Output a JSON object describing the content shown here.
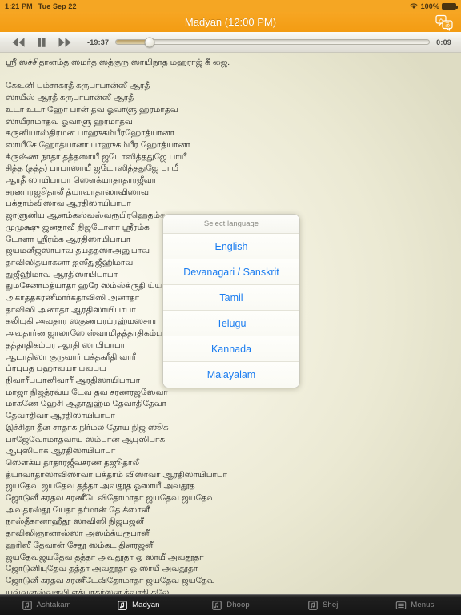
{
  "status_bar": {
    "time": "1:21 PM",
    "date": "Tue Sep 22",
    "battery_percent": "100%",
    "wifi_icon": "wifi-icon",
    "battery_icon": "battery-full-icon"
  },
  "nav_bar": {
    "title": "Madyan (12:00 PM)",
    "translate_icon": "translate-icon",
    "background_color": "#f5a623"
  },
  "transport": {
    "rewind_icon": "rewind-icon",
    "pause_icon": "pause-icon",
    "forward_icon": "fast-forward-icon",
    "elapsed": "-19:37",
    "remaining": "0:09",
    "progress_percent": 11,
    "fill_color": "#c9b584"
  },
  "popover": {
    "header": "Select language",
    "options": [
      {
        "label": "English"
      },
      {
        "label": "Devanagari / Sanskrit"
      },
      {
        "label": "Tamil"
      },
      {
        "label": "Telugu"
      },
      {
        "label": "Kannada"
      },
      {
        "label": "Malayalam"
      }
    ],
    "text_color": "#1a7cf0"
  },
  "lyrics": {
    "lines": [
      "ஸ்ரீ ஸச்சிதானம்த ஸமர்த ஸத்குரு ஸாயிநாத மஹராஜ் கீ ஜை.",
      "",
      "கேஉனி பம்சாகரதீ கருபாபான்ஸீ ஆரதீ",
      "ஸாயீஸ் ஆரதீ கருபாபான்ஸீ ஆரதீ",
      "உடா உடா ஹோ பான் தவ ஓவாளு ஹரமாதவ",
      "ஸாயீராமாதவ ஓவாளு ஹரமாதவ",
      "கருனியாஸ்திரமன பாஹுகம்பீரஹோத்யானா",
      "ஸாயீசே ஹோத்யானா பாஹுகம்பீர ஹோத்யானா",
      "க்ருஷ்ண நாதா தத்தஸாயீ ஜடோஸித்ததுஜே பாயீ",
      "சித்த (தத்த) பாபாஸாயீ ஜடோஸித்ததுஜே பாயீ",
      "ஆரதீ ஸாயிபாபா ஸௌக்யாதாதாரஜீவா",
      "சரணாரஜூதாலீ த்யாவாதாஸாவிஸாவ",
      "பக்தாம்விஸாவ ஆரதிஸாயிபாபா",
      "ஜாளுனிய ஆனம்கஸ்வஸ்வரூபிரஹெதம்க",
      "முமுக்ஷு ஜனதாவீ நிஜடோளா ஸ்ரீரம்க",
      "டோளா ஸ்ரீரம்க ஆரதிஸாயிபாபா",
      "ஜயமனீஜஸாபாவ தயததஸாஅனுபாவ",
      "தாவிஸிதயாகனா ஐஸீதுஜீஹிமாவ",
      "துஜீஹிமாவ ஆரதிஸாயிபாபா",
      "துமசேனாமத்யாதா ஹரே ஸம்ஸ்க்ருதி ய்யாதா",
      "அகாததகரணீமார்கதாவிஸி அனாதா",
      "தாவிஸி அனாதா ஆரதிஸாயிபாபா",
      "கலியுகி அவதார ஸகுணபரப்ரஹ்மஸசார",
      "அவதார்ணஜாலாஸே ஸ்வாமிதத்தாதிகம்பர",
      "தத்தாதிகம்பர ஆரதி ஸாயிபாபா",
      "ஆடாதிஸா குருவார் பக்தகரீதி வாரீ",
      "ப்ரபுபத பஹாவயா பவபய",
      "நிவாரீபயானிவாரீ ஆரதிஸாயிபாபா",
      "மாஜா நிஜத்ரவ்ய டேவ தவ சரணரஜஸேவா",
      "மாகணே ஹேசி ஆதாதுஹ்ம தேவாதிதேவா",
      "தேவாதிவா ஆரதிஸாயிபாபா",
      "இச்சிதா தீன சாதாக நிர்மல தோய நிஜ ஸூக",
      "பாஜேவோமாதவாய ஸம்பான ஆபுஸிபாக",
      "ஆபுஸிபாக ஆரதிஸாயிபாபா",
      "ஸௌக்ய தாதாரஜீவசரண தஜூதாலீ",
      "த்யாவாதாஸாவிஸாவா பக்தாம் விஸாவா ஆரதிஸாயிபாபா",
      "ஜயதேவ ஜயதேவ தத்தா அவதூத ஓஸாயீ அவதூத",
      "ஜோடுனீ கரதவ சரணீடேவிதோமாதா ஜயதேவ ஜயதேவ",
      "அவதரஸ்தூ யேதா தர்மான் தே க்ஸானீ",
      "நாஸ்தீகானாஹீதூ ஸாவிஸி நிஜபஜனீ",
      "தாவிஸிஞானாஸ்ஸா அஸம்க்யரூபானீ",
      "ஹரிஸீ தேவான் சேதூ ஸம்கட தினரஜனீ",
      "ஜயதேவஜயதேவ தத்தா அவதூதா ஓ ஸாயீ அவதூதா",
      "ஜோடுனியுதேவ தத்தா அவதூதா ஓ ஸாயீ அவதூதா",
      "ஜோடுனீ கரதவ சரணீடேவிதோமாதா ஜயதேவ ஜயதேவ",
      "யவ்வனஸ்வரூபி ஏக்யாதர்ஸன த்வாதி தலே"
    ]
  },
  "tab_bar": {
    "tabs": [
      {
        "label": "Ashtakam",
        "icon": "music-note-icon",
        "active": false
      },
      {
        "label": "Madyan",
        "icon": "music-note-icon",
        "active": true
      },
      {
        "label": "Dhoop",
        "icon": "music-note-icon",
        "active": false
      },
      {
        "label": "Shej",
        "icon": "music-note-icon",
        "active": false
      },
      {
        "label": "Menus",
        "icon": "menu-list-icon",
        "active": false
      }
    ]
  }
}
